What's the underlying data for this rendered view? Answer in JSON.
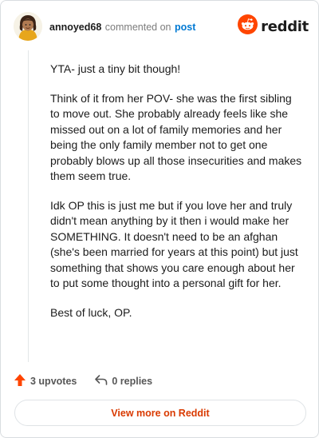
{
  "comment": {
    "username": "annoyed68",
    "commented_on_text": "commented on",
    "post_link": "post",
    "paragraphs": [
      "YTA- just a tiny bit though!",
      "Think of it from her POV- she was the first sibling to move out. She probably already feels like she missed out on a lot of family memories and her being the only family member not to get one probably blows up all those insecurities and makes them seem true.",
      "Idk OP this is just me but if you love her and truly didn't mean anything by it then i would make her SOMETHING. It doesn't need to be an afghan (she's been married for years at this point) but just something that shows you care enough about her to put some thought into a personal gift for her.",
      "Best of luck, OP."
    ]
  },
  "brand": {
    "wordmark": "reddit",
    "icon": "reddit-snoo-icon",
    "color": "#ff4500"
  },
  "actions": {
    "upvotes": "3 upvotes",
    "upvote_icon": "upvote-arrow-icon",
    "upvote_color": "#ff4500",
    "replies": "0 replies",
    "reply_icon": "reply-arrow-icon"
  },
  "footer": {
    "view_more": "View more on Reddit",
    "accent": "#d93a00"
  }
}
